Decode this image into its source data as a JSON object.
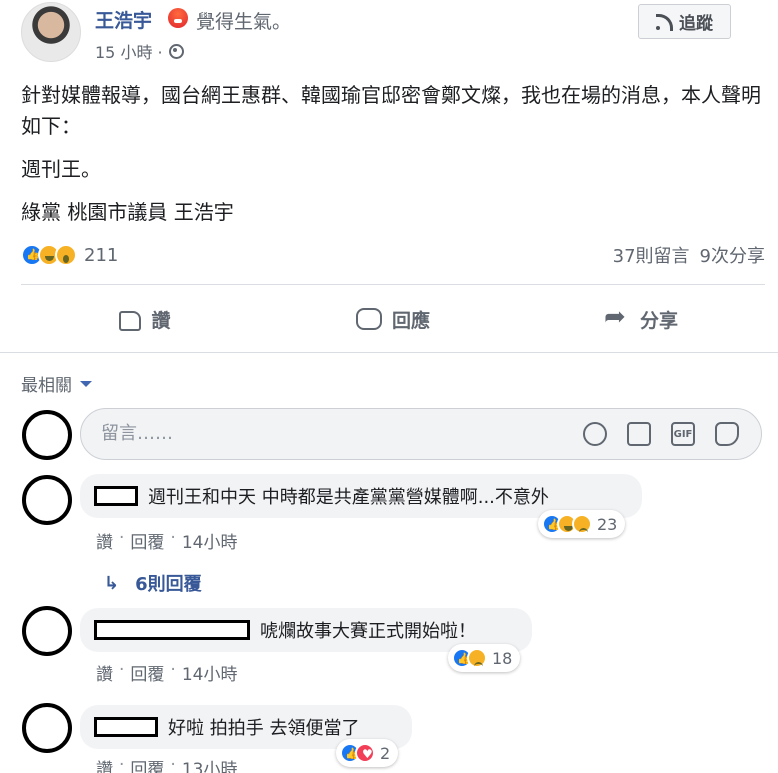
{
  "post": {
    "author": "王浩宇",
    "feeling": "覺得生氣。",
    "time": "15 小時 ·",
    "follow_label": "追蹤",
    "paragraphs": [
      "針對媒體報導，國台網王惠群、韓國瑜官邸密會鄭文燦，我也在場的消息，本人聲明如下：",
      "週刊王。",
      "綠黨 桃園市議員 王浩宇"
    ],
    "reaction_count": "211",
    "comments_count": "37則留言",
    "shares_count": "9次分享"
  },
  "actions": {
    "like": "讚",
    "comment": "回應",
    "share": "分享"
  },
  "sort": {
    "label": "最相關"
  },
  "comment_box": {
    "placeholder": "留言……"
  },
  "comments": [
    {
      "text": "週刊王和中天 中時都是共產黨黨營媒體啊...不意外",
      "reactions": "23",
      "like": "讚",
      "reply": "回覆",
      "time": "14小時",
      "replies": "6則回覆"
    },
    {
      "text": "唬爛故事大賽正式開始啦！",
      "reactions": "18",
      "like": "讚",
      "reply": "回覆",
      "time": "14小時"
    },
    {
      "text": "好啦 拍拍手 去領便當了",
      "reactions": "2",
      "like": "讚",
      "reply": "回覆",
      "time": "13小時"
    }
  ],
  "icons": [
    "rss-icon",
    "globe-icon",
    "thumb-icon",
    "comment-icon",
    "share-icon",
    "smile-icon",
    "camera-icon",
    "gif-icon",
    "sticker-icon"
  ],
  "gif_label": "GIF",
  "colors": {
    "link": "#385898",
    "accent": "#4267b2",
    "like": "#1877f2"
  }
}
